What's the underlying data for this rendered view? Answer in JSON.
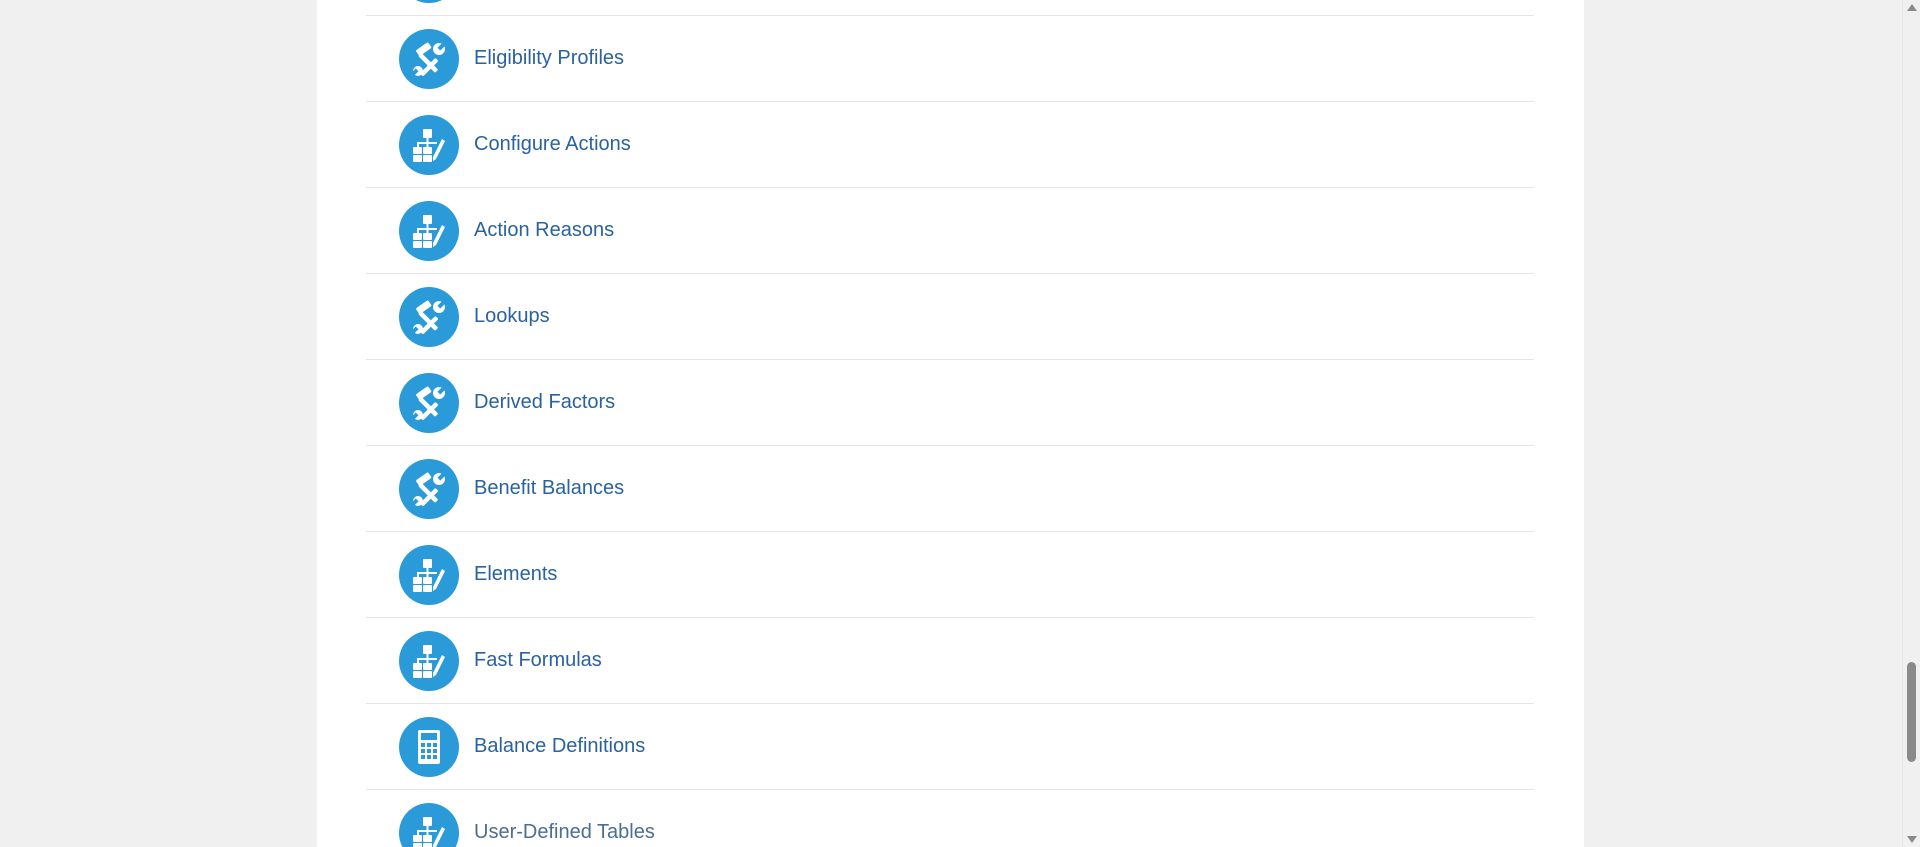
{
  "items": [
    {
      "label": "",
      "icon": "tools-icon"
    },
    {
      "label": "Eligibility Profiles",
      "icon": "tools-icon"
    },
    {
      "label": "Configure Actions",
      "icon": "hierarchy-edit-icon"
    },
    {
      "label": "Action Reasons",
      "icon": "hierarchy-edit-icon"
    },
    {
      "label": "Lookups",
      "icon": "tools-icon"
    },
    {
      "label": "Derived Factors",
      "icon": "tools-icon"
    },
    {
      "label": "Benefit Balances",
      "icon": "tools-icon"
    },
    {
      "label": "Elements",
      "icon": "hierarchy-edit-icon"
    },
    {
      "label": "Fast Formulas",
      "icon": "hierarchy-edit-icon"
    },
    {
      "label": "Balance Definitions",
      "icon": "calculator-icon"
    },
    {
      "label": "User-Defined Tables",
      "icon": "hierarchy-edit-icon"
    }
  ],
  "colors": {
    "icon_background": "#2b9ad8",
    "link_text": "#2a62a0",
    "page_background": "#f0f0f0",
    "panel_background": "#ffffff"
  }
}
